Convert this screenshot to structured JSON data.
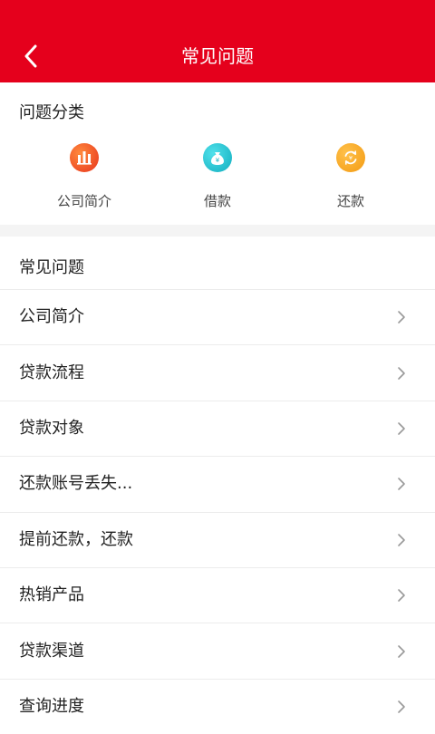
{
  "header": {
    "title": "常见问题"
  },
  "categories_section": {
    "title": "问题分类",
    "items": [
      {
        "label": "公司简介",
        "icon": "building-icon",
        "color": "#f04b1f"
      },
      {
        "label": "借款",
        "icon": "money-bag-icon",
        "color": "#1fb9c9"
      },
      {
        "label": "还款",
        "icon": "refund-cycle-icon",
        "color": "#f6a11b"
      }
    ]
  },
  "faq_section": {
    "title": "常见问题",
    "items": [
      {
        "label": "公司简介"
      },
      {
        "label": "贷款流程"
      },
      {
        "label": "贷款对象"
      },
      {
        "label": "还款账号丢失..."
      },
      {
        "label": "提前还款，还款"
      },
      {
        "label": "热销产品"
      },
      {
        "label": "贷款渠道"
      },
      {
        "label": "查询进度"
      }
    ]
  },
  "colors": {
    "brand": "#e5001c",
    "divider": "#f4f4f4"
  }
}
